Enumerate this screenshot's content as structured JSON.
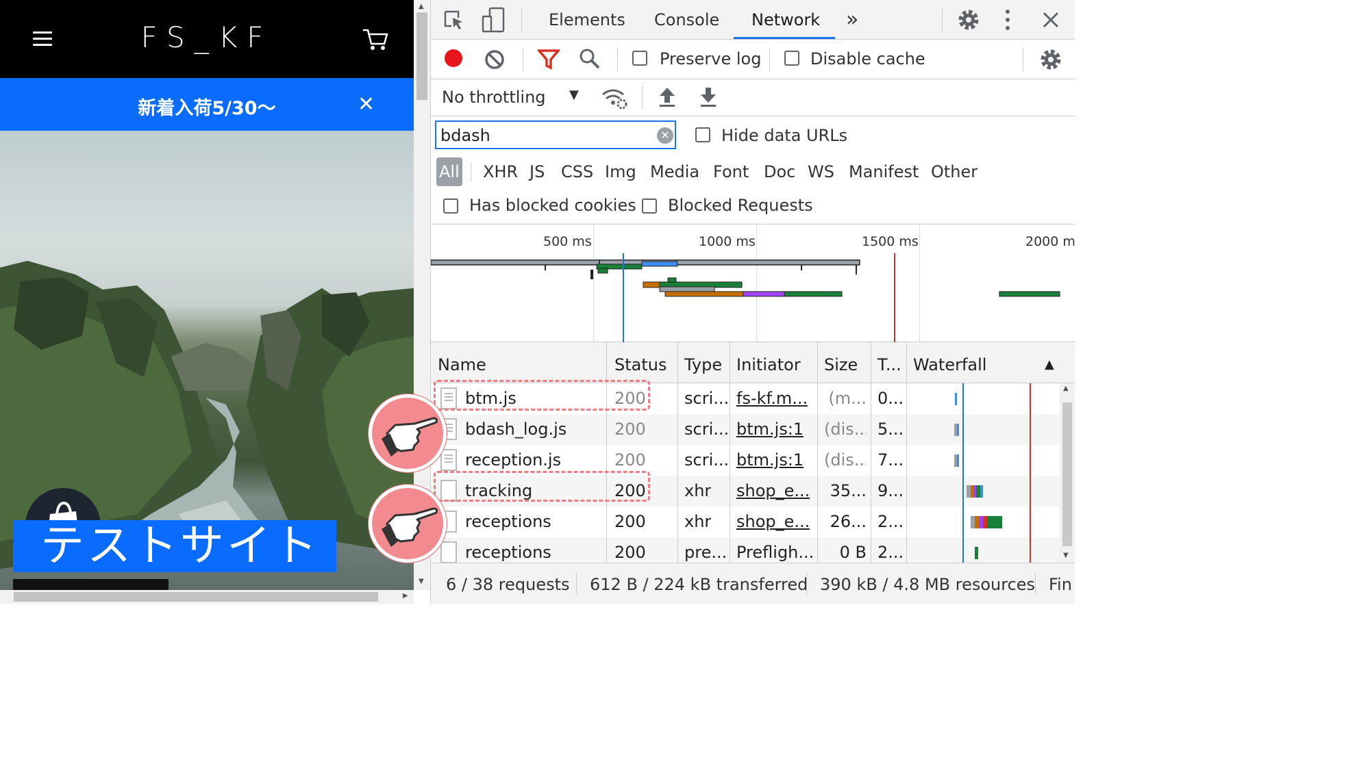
{
  "site": {
    "logo": "FS_KF",
    "announcement": "新着入荷5/30〜",
    "hero_title": "テストサイト",
    "icons": [
      "hamburger-icon",
      "cart-icon",
      "close-icon",
      "shopify-logo-icon"
    ]
  },
  "devtools": {
    "tabs": [
      {
        "label": "Elements",
        "active": false
      },
      {
        "label": "Console",
        "active": false
      },
      {
        "label": "Network",
        "active": true
      }
    ],
    "more_tabs": "»",
    "toolbar": {
      "preserve_log": "Preserve log",
      "disable_cache": "Disable cache",
      "throttling": "No throttling"
    },
    "filter": {
      "value": "bdash",
      "hide_data_urls": "Hide data URLs"
    },
    "types": [
      "All",
      "XHR",
      "JS",
      "CSS",
      "Img",
      "Media",
      "Font",
      "Doc",
      "WS",
      "Manifest",
      "Other"
    ],
    "active_type": "All",
    "blocked": {
      "has_blocked_cookies": "Has blocked cookies",
      "blocked_requests": "Blocked Requests"
    },
    "overview_ticks": [
      "500 ms",
      "1000 ms",
      "1500 ms",
      "2000 m"
    ],
    "columns": {
      "name": "Name",
      "status": "Status",
      "type": "Type",
      "initiator": "Initiator",
      "size": "Size",
      "time": "T...",
      "waterfall": "Waterfall"
    },
    "rows": [
      {
        "name": "btm.js",
        "status": "200",
        "type": "scri...",
        "initiator": "fs-kf.m...",
        "size": "(m...",
        "time": "0...",
        "highlighted": true
      },
      {
        "name": "bdash_log.js",
        "status": "200",
        "type": "scri...",
        "initiator": "btm.js:1",
        "size": "(dis...",
        "time": "5...",
        "highlighted": false
      },
      {
        "name": "reception.js",
        "status": "200",
        "type": "scri...",
        "initiator": "btm.js:1",
        "size": "(dis...",
        "time": "7...",
        "highlighted": false
      },
      {
        "name": "tracking",
        "status": "200",
        "type": "xhr",
        "initiator": "shop_e...",
        "size": "35...",
        "time": "9...",
        "highlighted": true
      },
      {
        "name": "receptions",
        "status": "200",
        "type": "xhr",
        "initiator": "shop_e...",
        "size": "26...",
        "time": "2...",
        "highlighted": false
      },
      {
        "name": "receptions",
        "status": "200",
        "type": "pre...",
        "initiator": "Prefligh...",
        "size": "0 B",
        "time": "2...",
        "highlighted": false
      }
    ],
    "status_bar": {
      "requests": "6 / 38 requests",
      "transferred": "612 B / 224 kB transferred",
      "resources": "390 kB / 4.8 MB resources",
      "finish": "Fin"
    },
    "colors": {
      "accent": "#1a73e8",
      "record": "#e8151b",
      "filter_active": "#d93025",
      "highlight": "#ef7b82"
    }
  }
}
